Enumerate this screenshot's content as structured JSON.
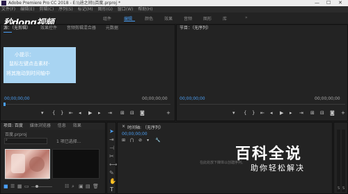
{
  "window": {
    "title": "Adobe Premiere Pro CC 2018 - E:\\\\迪之间\\\\百度.prproj *",
    "min": "—",
    "max": "☐",
    "close": "✕"
  },
  "menu": [
    "文件(F)",
    "编辑(E)",
    "剪辑(C)",
    "序列(S)",
    "标记(M)",
    "图形(G)",
    "窗口(W)",
    "帮助(H)"
  ],
  "workspaces": [
    "组件",
    "编辑",
    "颜色",
    "效果",
    "音频",
    "图形",
    "库"
  ],
  "active_workspace": "编辑",
  "watermark_logo": "秒dong视频",
  "source_panel": {
    "tabs": [
      "源：（无剪辑）",
      "效果控件",
      "音频剪辑混合器",
      "元数据"
    ],
    "timecode_left": "00;00;00;00",
    "timecode_right": "00;00;00;00"
  },
  "program_panel": {
    "tabs": [
      "节目：（无序列）"
    ],
    "timecode_left": "00;00;00;00",
    "timecode_right": "00;00;00;00"
  },
  "tooltip": {
    "line1": "小提示：",
    "line2": "鼠标左键点击素材-",
    "line3": "将其拖动到时间轴中"
  },
  "project_panel": {
    "tabs": [
      "项目: 百度",
      "媒体浏览器",
      "信息",
      "效果"
    ],
    "path": "百度.prproj",
    "search_placeholder": "",
    "item_count": "1 项已选择..."
  },
  "timeline_panel": {
    "tab": "时间轴: （无序列）",
    "timecode": "00;00;00;00",
    "hint": "在此处放下媒体以创建序列。"
  },
  "watermark": {
    "title": "百科全说",
    "subtitle": "助你轻松解决"
  },
  "icons": [
    "play-icon",
    "step-back-icon",
    "step-forward-icon",
    "selection-tool-icon",
    "razor-icon",
    "pen-icon",
    "hand-icon",
    "type-icon",
    "wrench-icon"
  ]
}
